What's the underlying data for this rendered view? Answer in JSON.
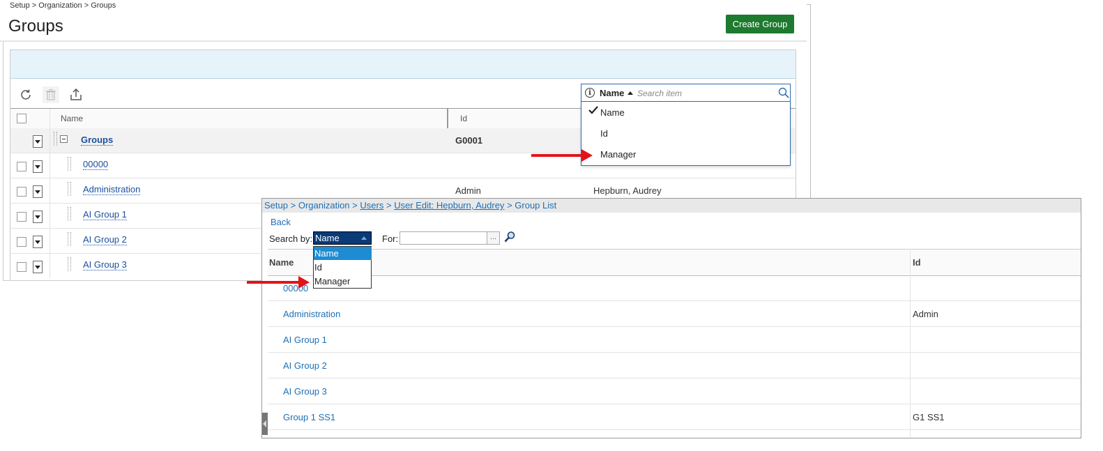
{
  "top": {
    "breadcrumb": "Setup > Organization > Groups",
    "title": "Groups",
    "create_button": "Create Group",
    "columns": {
      "name": "Name",
      "id": "Id"
    },
    "rows": [
      {
        "name": "Groups",
        "id": "G0001",
        "manager": ""
      },
      {
        "name": "00000",
        "id": "",
        "manager": ""
      },
      {
        "name": "Administration",
        "id": "Admin",
        "manager": "Hepburn, Audrey"
      },
      {
        "name": "AI Group 1",
        "id": "",
        "manager": ""
      },
      {
        "name": "AI Group 2",
        "id": "",
        "manager": ""
      },
      {
        "name": "AI Group 3",
        "id": "",
        "manager": ""
      }
    ],
    "search": {
      "field": "Name",
      "placeholder": "Search item",
      "options": [
        "Name",
        "Id",
        "Manager"
      ],
      "checked": "Name"
    }
  },
  "old": {
    "breadcrumb": {
      "setup": "Setup",
      "organization": "Organization",
      "users": "Users",
      "user_edit": "User Edit: Hepburn, Audrey",
      "group_list": "Group List",
      "sep": ">"
    },
    "back": "Back",
    "search_by_label": "Search by:",
    "search_by_value": "Name",
    "search_by_options": [
      "Name",
      "Id",
      "Manager"
    ],
    "for_label": "For:",
    "for_button": "...",
    "columns": {
      "name": "Name",
      "id": "Id"
    },
    "rows": [
      {
        "name": "00000",
        "id": ""
      },
      {
        "name": "Administration",
        "id": "Admin"
      },
      {
        "name": "AI Group 1",
        "id": ""
      },
      {
        "name": "AI Group 2",
        "id": ""
      },
      {
        "name": "AI Group 3",
        "id": ""
      },
      {
        "name": "Group 1 SS1",
        "id": "G1 SS1"
      }
    ]
  },
  "colors": {
    "accent_green": "#1d7a2e",
    "link_blue": "#1a4f9c",
    "arrow_red": "#e1141a",
    "select_highlight": "#1e8cd3"
  }
}
